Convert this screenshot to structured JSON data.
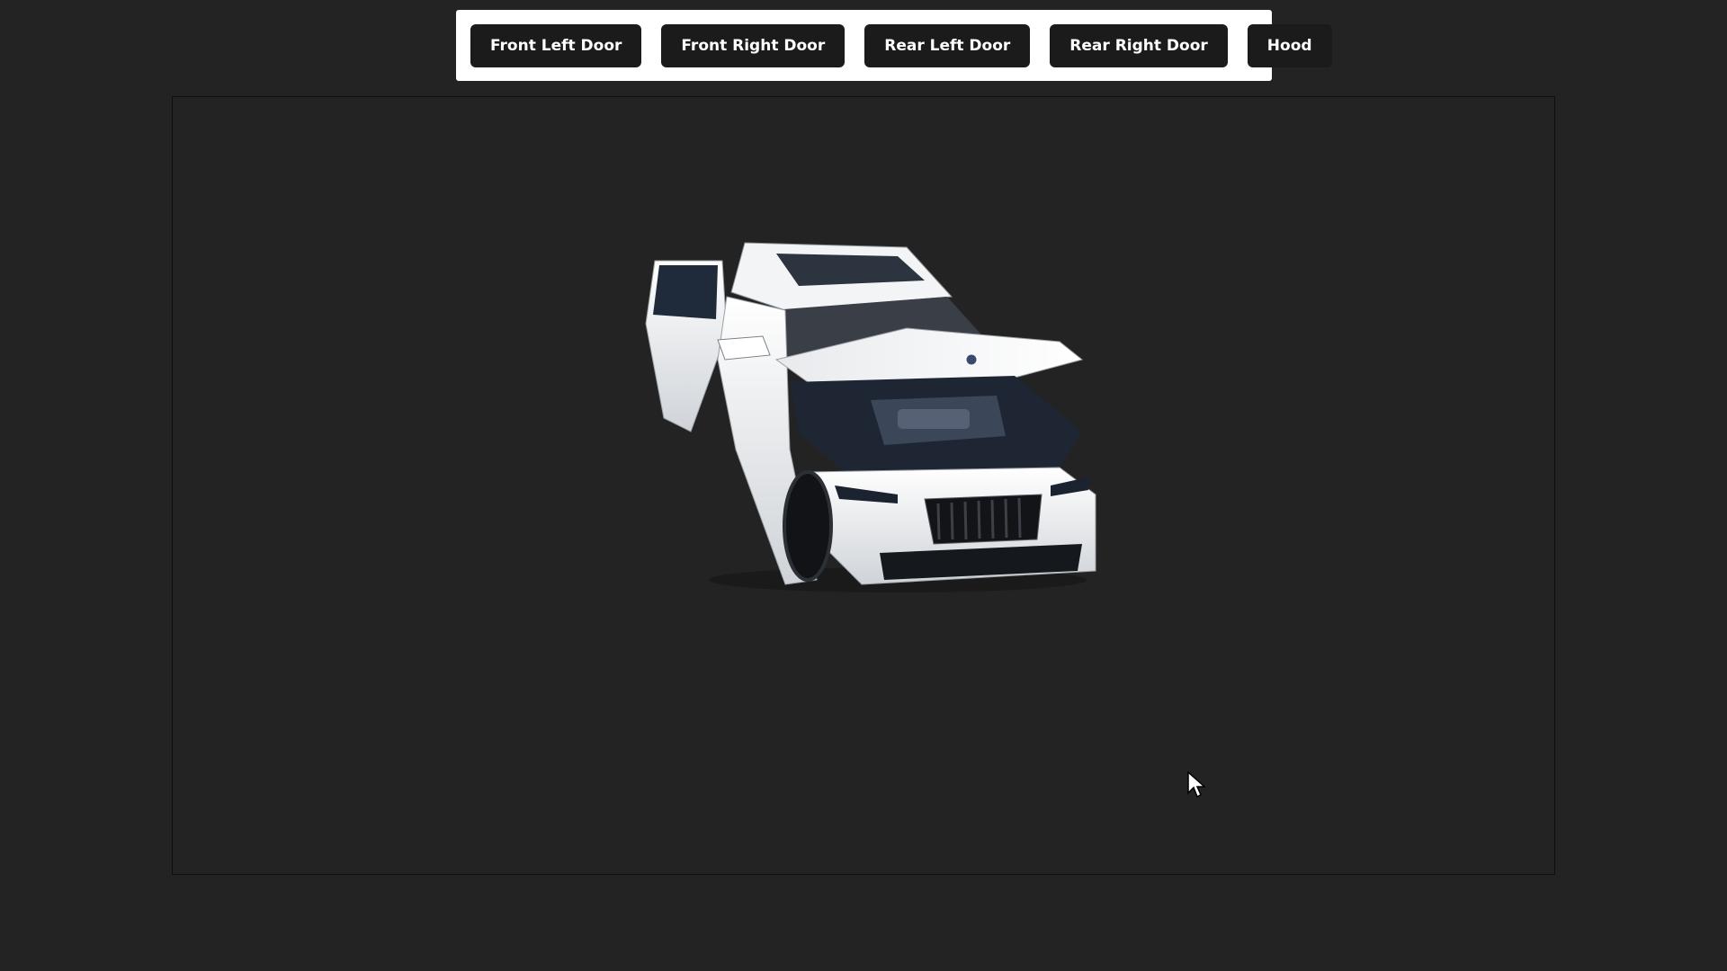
{
  "toolbar": {
    "buttons": [
      {
        "label": "Front Left Door"
      },
      {
        "label": "Front Right Door"
      },
      {
        "label": "Rear Left Door"
      },
      {
        "label": "Rear Right Door"
      },
      {
        "label": "Hood"
      }
    ]
  },
  "viewer": {
    "model_icon": "car-3d-model-icon",
    "cursor_icon": "mouse-pointer-icon"
  },
  "colors": {
    "page_background": "#232323",
    "toolbar_background": "#ffffff",
    "button_background": "#1b1b1b",
    "button_text": "#ffffff"
  }
}
